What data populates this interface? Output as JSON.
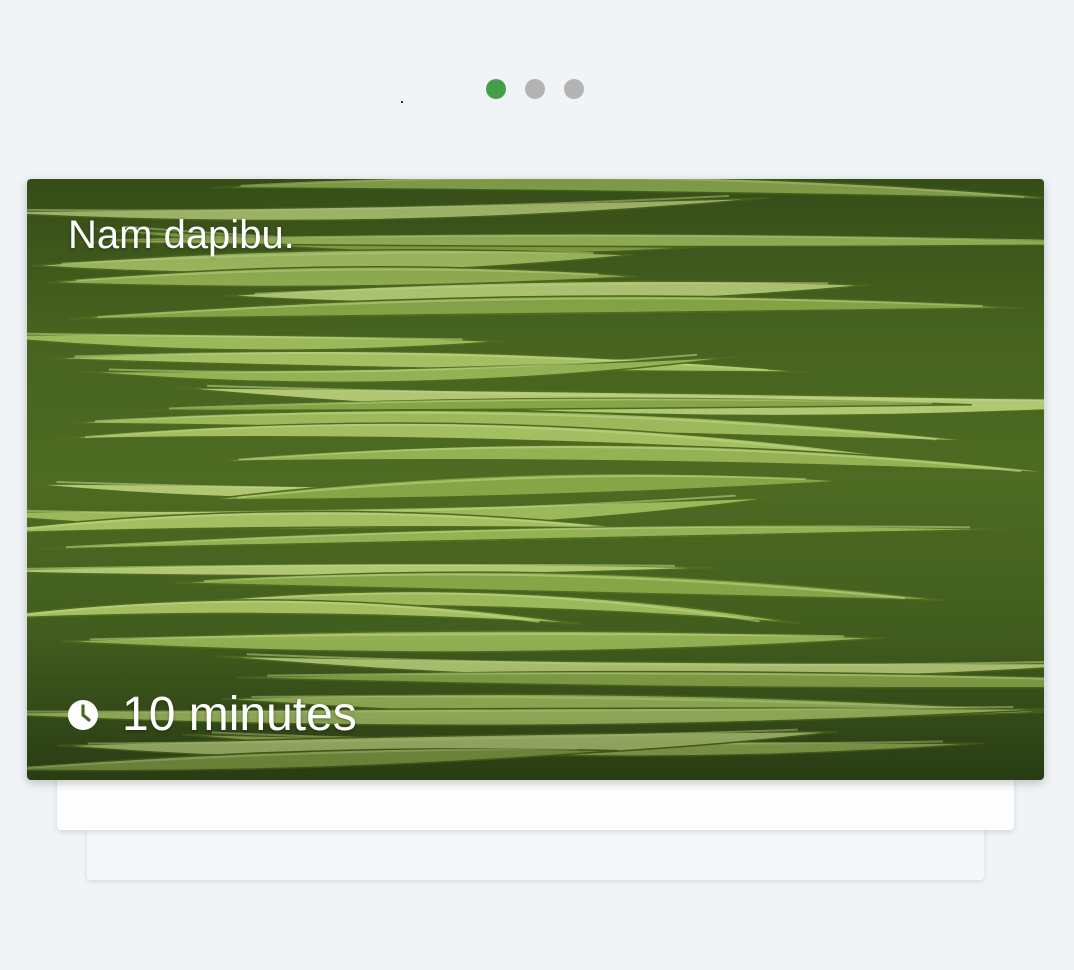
{
  "carousel": {
    "pages": [
      {
        "state": "active",
        "color": "#43a047"
      },
      {
        "state": "inactive",
        "color": "#b3b3b3"
      },
      {
        "state": "inactive",
        "color": "#b3b3b3"
      }
    ],
    "active_index": 0
  },
  "card": {
    "title": "Nam dapibu.",
    "duration": "10 minutes",
    "duration_icon": "clock-icon",
    "image_subject": "green-beans-photo"
  }
}
